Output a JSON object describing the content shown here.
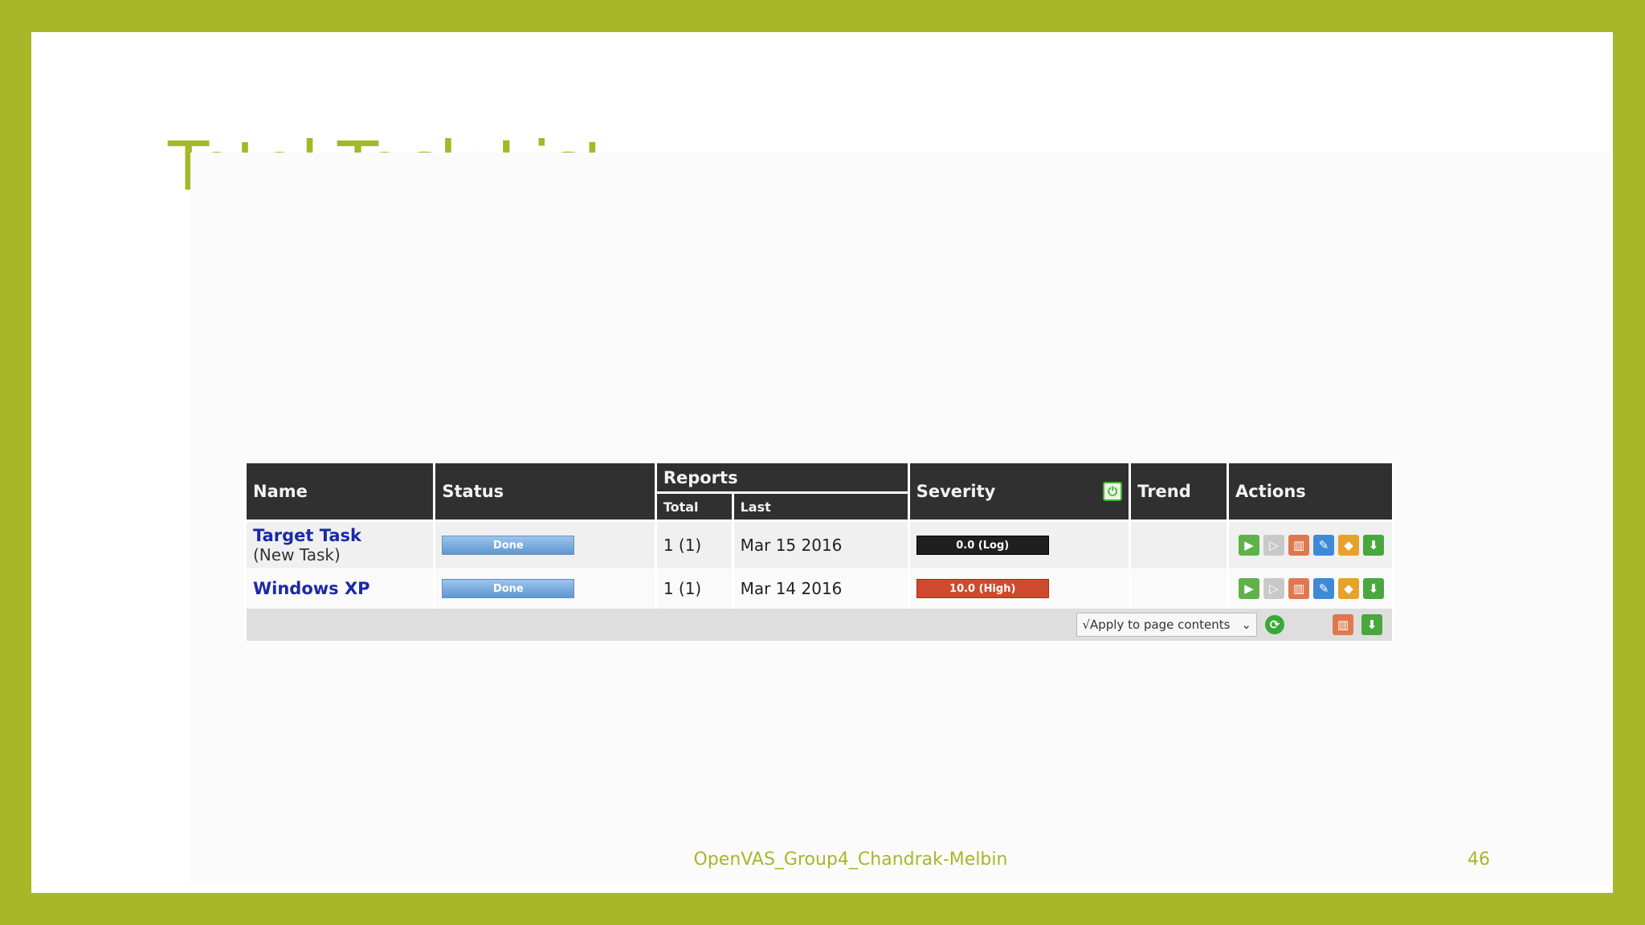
{
  "slide": {
    "title": "Total Task List",
    "footer": "OpenVAS_Group4_Chandrak-Melbin",
    "page_number": "46"
  },
  "table": {
    "headers": {
      "name": "Name",
      "status": "Status",
      "reports": "Reports",
      "reports_total": "Total",
      "reports_last": "Last",
      "severity": "Severity",
      "trend": "Trend",
      "actions": "Actions"
    },
    "rows": [
      {
        "name": "Target Task",
        "comment": "(New Task)",
        "status": "Done",
        "total": "1 (1)",
        "last": "Mar 15 2016",
        "severity": "0.0 (Log)",
        "severity_color": "#1f1f1f",
        "trend": ""
      },
      {
        "name": "Windows XP",
        "comment": "",
        "status": "Done",
        "total": "1 (1)",
        "last": "Mar 14 2016",
        "severity": "10.0 (High)",
        "severity_color": "#cf4a2c",
        "trend": ""
      }
    ],
    "action_icons": [
      "start-icon",
      "resume-icon",
      "trash-icon",
      "edit-icon",
      "export-icon",
      "download-icon"
    ],
    "footer": {
      "apply_select": "√Apply to page contents",
      "bulk_icons": [
        "refresh-icon",
        "trash-icon",
        "download-icon"
      ]
    }
  },
  "colors": {
    "accent": "#a6b728",
    "header_bg": "#303030",
    "link": "#1a2aa8"
  }
}
